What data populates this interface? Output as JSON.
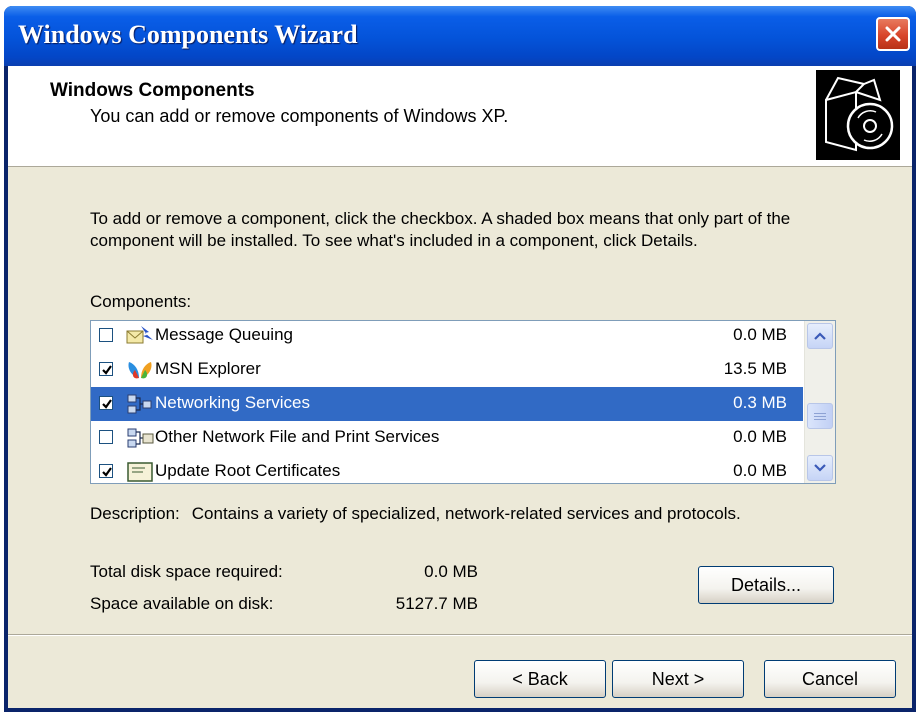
{
  "window": {
    "title": "Windows Components Wizard",
    "close_icon": "close-x-icon"
  },
  "header": {
    "title": "Windows Components",
    "subtitle": "You can add or remove components of Windows XP.",
    "icon": "box-with-cd-icon"
  },
  "body": {
    "instructions": "To add or remove a component, click the checkbox.  A shaded box means that only part of the component will be installed.  To see what's included in a component, click Details.",
    "components_label": "Components:",
    "components": [
      {
        "name": "Message Queuing",
        "size": "0.0 MB",
        "checked": false,
        "selected": false,
        "icon": "message-queuing-icon"
      },
      {
        "name": "MSN Explorer",
        "size": "13.5 MB",
        "checked": true,
        "selected": false,
        "icon": "msn-butterfly-icon"
      },
      {
        "name": "Networking Services",
        "size": "0.3 MB",
        "checked": true,
        "selected": true,
        "icon": "networking-services-icon"
      },
      {
        "name": "Other Network File and Print Services",
        "size": "0.0 MB",
        "checked": false,
        "selected": false,
        "icon": "network-file-print-icon"
      },
      {
        "name": "Update Root Certificates",
        "size": "0.0 MB",
        "checked": true,
        "selected": false,
        "icon": "certificate-icon"
      }
    ],
    "description_label": "Description:",
    "description_text": "Contains a variety of specialized, network-related services and protocols.",
    "total_disk_label": "Total disk space required:",
    "total_disk_value": "0.0 MB",
    "available_label": "Space available on disk:",
    "available_value": "5127.7 MB",
    "details_button": "Details..."
  },
  "footer": {
    "back_button": "< Back",
    "next_button": "Next >",
    "cancel_button": "Cancel"
  },
  "colors": {
    "title_bar": "#0453d9",
    "selection": "#316ac5",
    "dialog_face": "#ece9d8",
    "close_button": "#d8452b"
  }
}
